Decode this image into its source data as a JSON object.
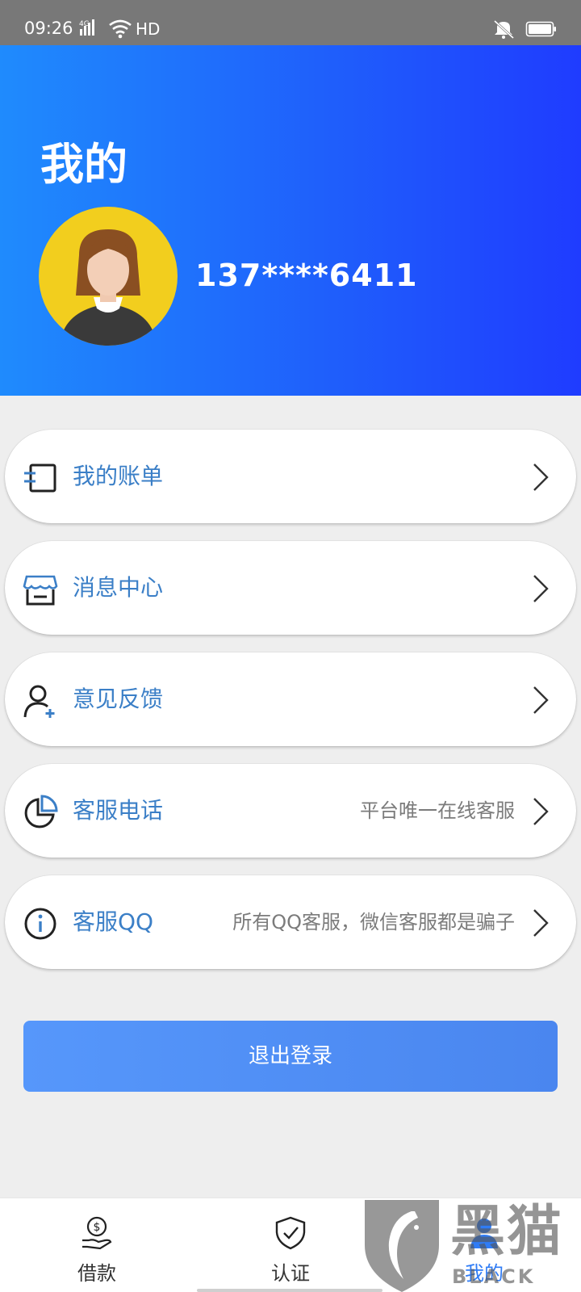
{
  "status_bar": {
    "time": "09:26",
    "network": "4G",
    "hd": "HD"
  },
  "header": {
    "title": "我的",
    "phone": "137****6411",
    "gradient_start": "#1f8bfd",
    "gradient_end": "#1f3cff"
  },
  "menu": {
    "items": [
      {
        "label": "我的账单",
        "icon": "bill-icon",
        "subtitle": ""
      },
      {
        "label": "消息中心",
        "icon": "store-icon",
        "subtitle": ""
      },
      {
        "label": "意见反馈",
        "icon": "user-add-icon",
        "subtitle": ""
      },
      {
        "label": "客服电话",
        "icon": "pie-chart-icon",
        "subtitle": "平台唯一在线客服"
      },
      {
        "label": "客服QQ",
        "icon": "info-icon",
        "subtitle": "所有QQ客服，微信客服都是骗子"
      }
    ]
  },
  "logout_label": "退出登录",
  "tabbar": {
    "tabs": [
      {
        "label": "借款",
        "icon": "loan-icon",
        "active": false
      },
      {
        "label": "认证",
        "icon": "shield-check-icon",
        "active": false
      },
      {
        "label": "我的",
        "icon": "profile-icon",
        "active": true
      }
    ],
    "active_color": "#2f7cf6"
  },
  "watermark": {
    "text_cn": "黑猫",
    "text_en": "BLACK CAT"
  },
  "colors": {
    "menu_label": "#3b7fc7",
    "logout_button": "#5697fb",
    "page_background": "#eeeeee"
  }
}
